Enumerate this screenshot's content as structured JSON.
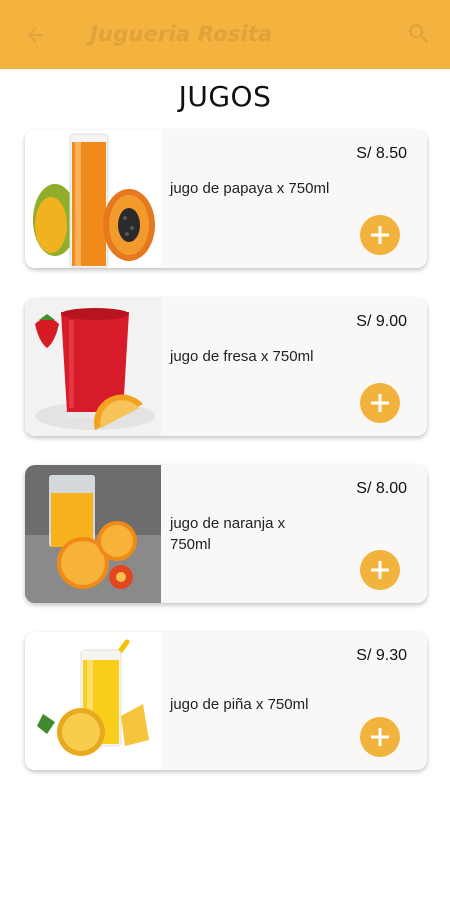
{
  "appbar": {
    "title": "Jugueria Rosita",
    "back_icon": "arrow-left-icon",
    "search_icon": "search-icon",
    "color": "#f3b33e"
  },
  "section": {
    "title": "JUGOS"
  },
  "products": [
    {
      "name": "jugo de papaya x 750ml",
      "price": "S/ 8.50",
      "image": "papaya-juice-image"
    },
    {
      "name": "jugo de fresa x 750ml",
      "price": "S/ 9.00",
      "image": "strawberry-juice-image"
    },
    {
      "name": "jugo de naranja x 750ml",
      "price": "S/ 8.00",
      "image": "orange-juice-image"
    },
    {
      "name": "jugo de piña x 750ml",
      "price": "S/ 9.30",
      "image": "pineapple-juice-image"
    }
  ],
  "add_button": {
    "icon": "plus-icon",
    "color": "#f2b33d"
  }
}
